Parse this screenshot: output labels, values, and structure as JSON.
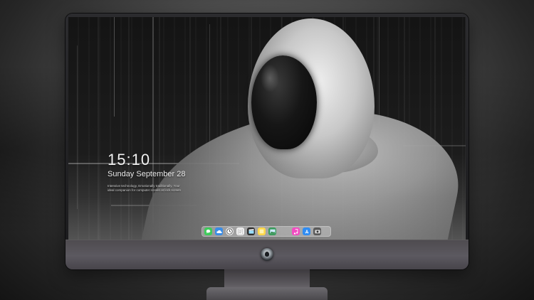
{
  "lock_screen": {
    "time": "15:10",
    "date": "Sunday September 28",
    "spotlight_text": "Intensive technology, Emotionally traditionally. Your ideal companion for computer screen at lock screen"
  },
  "dock": {
    "items": [
      {
        "name": "messages-icon",
        "color": "#3ecb5a"
      },
      {
        "name": "cloud-icon",
        "color": "#3a8de6"
      },
      {
        "name": "clock-icon",
        "color": "#e8e8e8"
      },
      {
        "name": "notes-icon",
        "color": "#f0f0f0"
      },
      {
        "name": "clapper-icon",
        "color": "#2f2f2f"
      },
      {
        "name": "sticky-note-icon",
        "color": "#ffd84a"
      },
      {
        "name": "photos-icon",
        "color": "#3a9b5c"
      },
      {
        "name": "music-icon",
        "color": "#f24cc2"
      },
      {
        "name": "app-store-icon",
        "color": "#2f8cf2"
      },
      {
        "name": "camera-icon",
        "color": "#5a5a5a"
      }
    ]
  },
  "colors": {
    "monitor_bezel": "#1e1e20",
    "monitor_chin": "#57545a",
    "clock_text": "#f2f2f2"
  }
}
